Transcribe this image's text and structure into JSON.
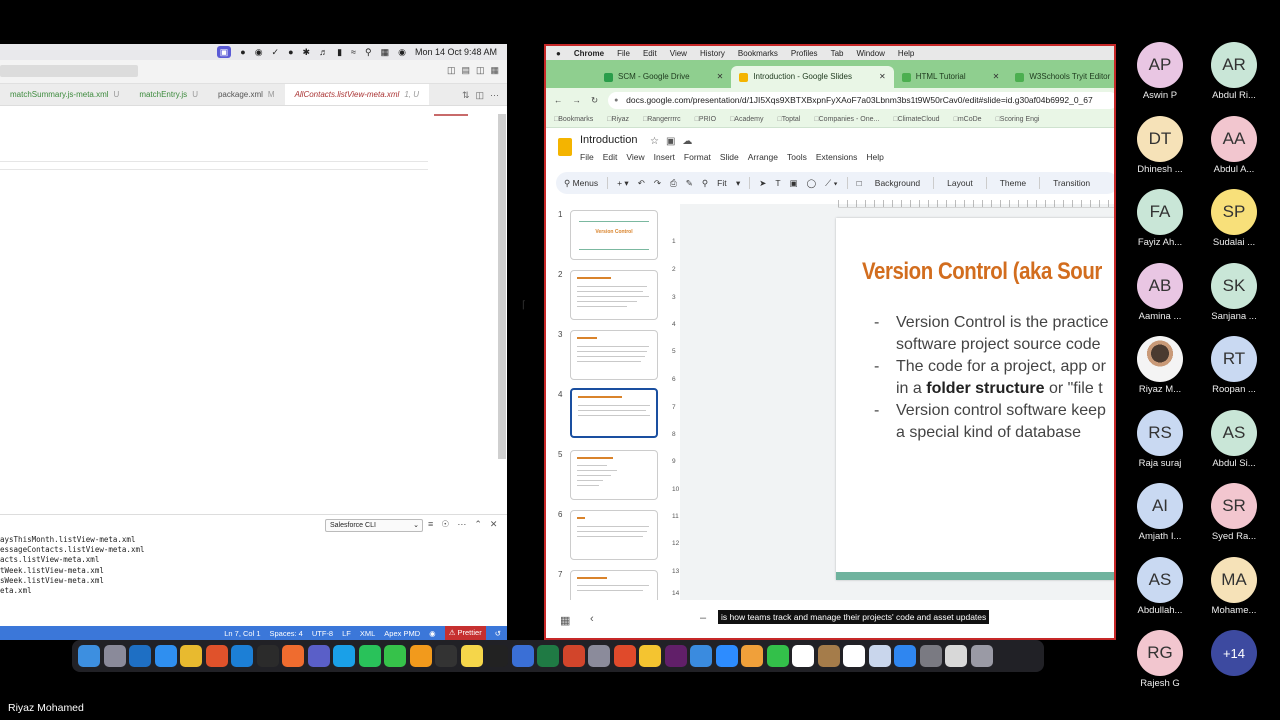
{
  "vscode": {
    "menubar": {
      "clock": "Mon 14 Oct  9:48 AM"
    },
    "tabs": [
      {
        "label": "matchSummary.js-meta.xml",
        "mark": "U",
        "style": "green"
      },
      {
        "label": "matchEntry.js",
        "mark": "U",
        "style": "green"
      },
      {
        "label": "package.xml",
        "mark": "M",
        "style": "plain"
      },
      {
        "label": "AllContacts.listView-meta.xml",
        "mark": "1, U",
        "style": "active"
      }
    ],
    "panel": {
      "channel": "Salesforce CLI",
      "output": [
        "aysThisMonth.listView-meta.xml",
        "essageContacts.listView-meta.xml",
        "acts.listView-meta.xml",
        "tWeek.listView-meta.xml",
        "sWeek.listView-meta.xml",
        "eta.xml"
      ]
    },
    "status": {
      "position": "Ln 7, Col 1",
      "spaces": "Spaces: 4",
      "encoding": "UTF-8",
      "eol": "LF",
      "language": "XML",
      "apex": "Apex PMD",
      "prettier": "Prettier"
    }
  },
  "chrome": {
    "menubar": [
      "Chrome",
      "File",
      "Edit",
      "View",
      "History",
      "Bookmarks",
      "Profiles",
      "Tab",
      "Window",
      "Help"
    ],
    "tabs": [
      {
        "label": "SCM - Google Drive",
        "color": "#2a9d4a",
        "active": false
      },
      {
        "label": "Introduction - Google Slides",
        "color": "#f4b400",
        "active": true
      },
      {
        "label": "HTML Tutorial",
        "color": "#4caf50",
        "active": false
      },
      {
        "label": "W3Schools Tryit Editor",
        "color": "#4caf50",
        "active": false
      }
    ],
    "url": "docs.google.com/presentation/d/1JI5Xqs9XBTXBxpnFyXAoF7a03Lbnm3bs1t9W50rCav0/edit#slide=id.g30af04b6992_0_67",
    "bookmarks": [
      "Bookmarks",
      "Riyaz",
      "Rangerrrrc",
      "PRIO",
      "Academy",
      "Toptal",
      "Companies - One...",
      "ClimateCloud",
      "mCoDe",
      "Scoring Engi"
    ]
  },
  "slides": {
    "doc_title": "Introduction",
    "menu": [
      "File",
      "Edit",
      "View",
      "Insert",
      "Format",
      "Slide",
      "Arrange",
      "Tools",
      "Extensions",
      "Help"
    ],
    "toolbar": {
      "menus": "Menus",
      "zoom": "Fit",
      "background": "Background",
      "layout": "Layout",
      "theme": "Theme",
      "transition": "Transition"
    },
    "thumb_numbers": [
      "1",
      "2",
      "3",
      "4",
      "5",
      "6",
      "7"
    ],
    "thumb1_title": "Version Control",
    "ruler_left": [
      "1",
      "2",
      "3",
      "4",
      "5",
      "6",
      "7",
      "8",
      "9",
      "10",
      "11",
      "12",
      "13",
      "14"
    ],
    "current_slide": {
      "title": "Version Control (aka Sour",
      "bullets": [
        {
          "dash": "-",
          "line1": "Version Control is the practice",
          "line2": "software project source code"
        },
        {
          "dash": "-",
          "line1": "The code for a project, app or",
          "line2_pre": "in a ",
          "line2_bold": "folder structure",
          "line2_post": " or \"file t"
        },
        {
          "dash": "-",
          "line1": "Version control software keep",
          "line2": "a special kind of database"
        }
      ]
    },
    "caption": "is how teams track and manage their projects' code and asset updates"
  },
  "dock": {
    "icons": [
      {
        "name": "finder-icon",
        "color": "#3d8fe0"
      },
      {
        "name": "launchpad-icon",
        "color": "#8a8a9a"
      },
      {
        "name": "outlook-icon",
        "color": "#1e6fc4"
      },
      {
        "name": "safari-icon",
        "color": "#2f8ff0"
      },
      {
        "name": "chrome-icon",
        "color": "#e8ba2f"
      },
      {
        "name": "firefox-icon",
        "color": "#e0522b"
      },
      {
        "name": "vscode-icon",
        "color": "#1c7fd6"
      },
      {
        "name": "terminal-icon",
        "color": "#2b2b2b"
      },
      {
        "name": "postman-icon",
        "color": "#ef6c2f"
      },
      {
        "name": "teams-icon",
        "color": "#5a5fc8"
      },
      {
        "name": "skype-icon",
        "color": "#1aa0e8"
      },
      {
        "name": "whatsapp-icon",
        "color": "#29c25a"
      },
      {
        "name": "messages-icon",
        "color": "#36c24a"
      },
      {
        "name": "sublime-icon",
        "color": "#f29a1c"
      },
      {
        "name": "openai-icon",
        "color": "#333333"
      },
      {
        "name": "notes-icon",
        "color": "#f5d64a"
      },
      {
        "name": "figma-icon",
        "color": "#222222"
      },
      {
        "name": "freeform-icon",
        "color": "#3a6fd6"
      },
      {
        "name": "excel-icon",
        "color": "#1f7a44"
      },
      {
        "name": "powerpoint-icon",
        "color": "#d2452b"
      },
      {
        "name": "preview-icon",
        "color": "#8b8b9b"
      },
      {
        "name": "compass-icon",
        "color": "#e04a2b"
      },
      {
        "name": "drive-icon",
        "color": "#f4c430"
      },
      {
        "name": "slack-icon",
        "color": "#611f69"
      },
      {
        "name": "keynote-icon",
        "color": "#3a8bdf"
      },
      {
        "name": "zoom-icon",
        "color": "#2d8cff"
      },
      {
        "name": "photos-icon",
        "color": "#f0a03a"
      },
      {
        "name": "facetime-icon",
        "color": "#33c04a"
      },
      {
        "name": "calendar-icon",
        "color": "#ffffff"
      },
      {
        "name": "archive-icon",
        "color": "#a57c4a"
      },
      {
        "name": "reminders-icon",
        "color": "#ffffff"
      },
      {
        "name": "pages-icon",
        "color": "#c9d6ec"
      },
      {
        "name": "appstore-icon",
        "color": "#2f86f0"
      },
      {
        "name": "settings-icon",
        "color": "#7a7a82"
      },
      {
        "name": "textedit-icon",
        "color": "#d8d8d8"
      },
      {
        "name": "trash-icon",
        "color": "#9a9aa5"
      }
    ]
  },
  "participants": [
    {
      "initials": "AP",
      "name": "Aswin P",
      "color": "#e9c6e3"
    },
    {
      "initials": "AR",
      "name": "Abdul Ri...",
      "color": "#c9e6d7"
    },
    {
      "initials": "DT",
      "name": "Dhinesh ...",
      "color": "#f6e2b8"
    },
    {
      "initials": "AA",
      "name": "Abdul A...",
      "color": "#f2c6cf"
    },
    {
      "initials": "FA",
      "name": "Fayiz Ah...",
      "color": "#c9e6d7"
    },
    {
      "initials": "SP",
      "name": "Sudalai ...",
      "color": "#f8e07a"
    },
    {
      "initials": "AB",
      "name": "Aamina ...",
      "color": "#e9c6e3"
    },
    {
      "initials": "SK",
      "name": "Sanjana ...",
      "color": "#c9e6d7"
    },
    {
      "initials": "",
      "name": "Riyaz M...",
      "color": "#f4f4f4"
    },
    {
      "initials": "RT",
      "name": "Roopan ...",
      "color": "#c9d9f2"
    },
    {
      "initials": "RS",
      "name": "Raja suraj",
      "color": "#c9d9f2"
    },
    {
      "initials": "AS",
      "name": "Abdul Si...",
      "color": "#c9e6d7"
    },
    {
      "initials": "AI",
      "name": "Amjath I...",
      "color": "#c9d9f2"
    },
    {
      "initials": "SR",
      "name": "Syed Ra...",
      "color": "#f2c6cf"
    },
    {
      "initials": "AS",
      "name": "Abdullah...",
      "color": "#c9d9f2"
    },
    {
      "initials": "MA",
      "name": "Mohame...",
      "color": "#f6e2b8"
    },
    {
      "initials": "RG",
      "name": "Rajesh G",
      "color": "#f2c6cf"
    },
    {
      "initials": "+14",
      "name": "",
      "color": "#3d4aa0"
    }
  ],
  "self_name": "Riyaz Mohamed"
}
